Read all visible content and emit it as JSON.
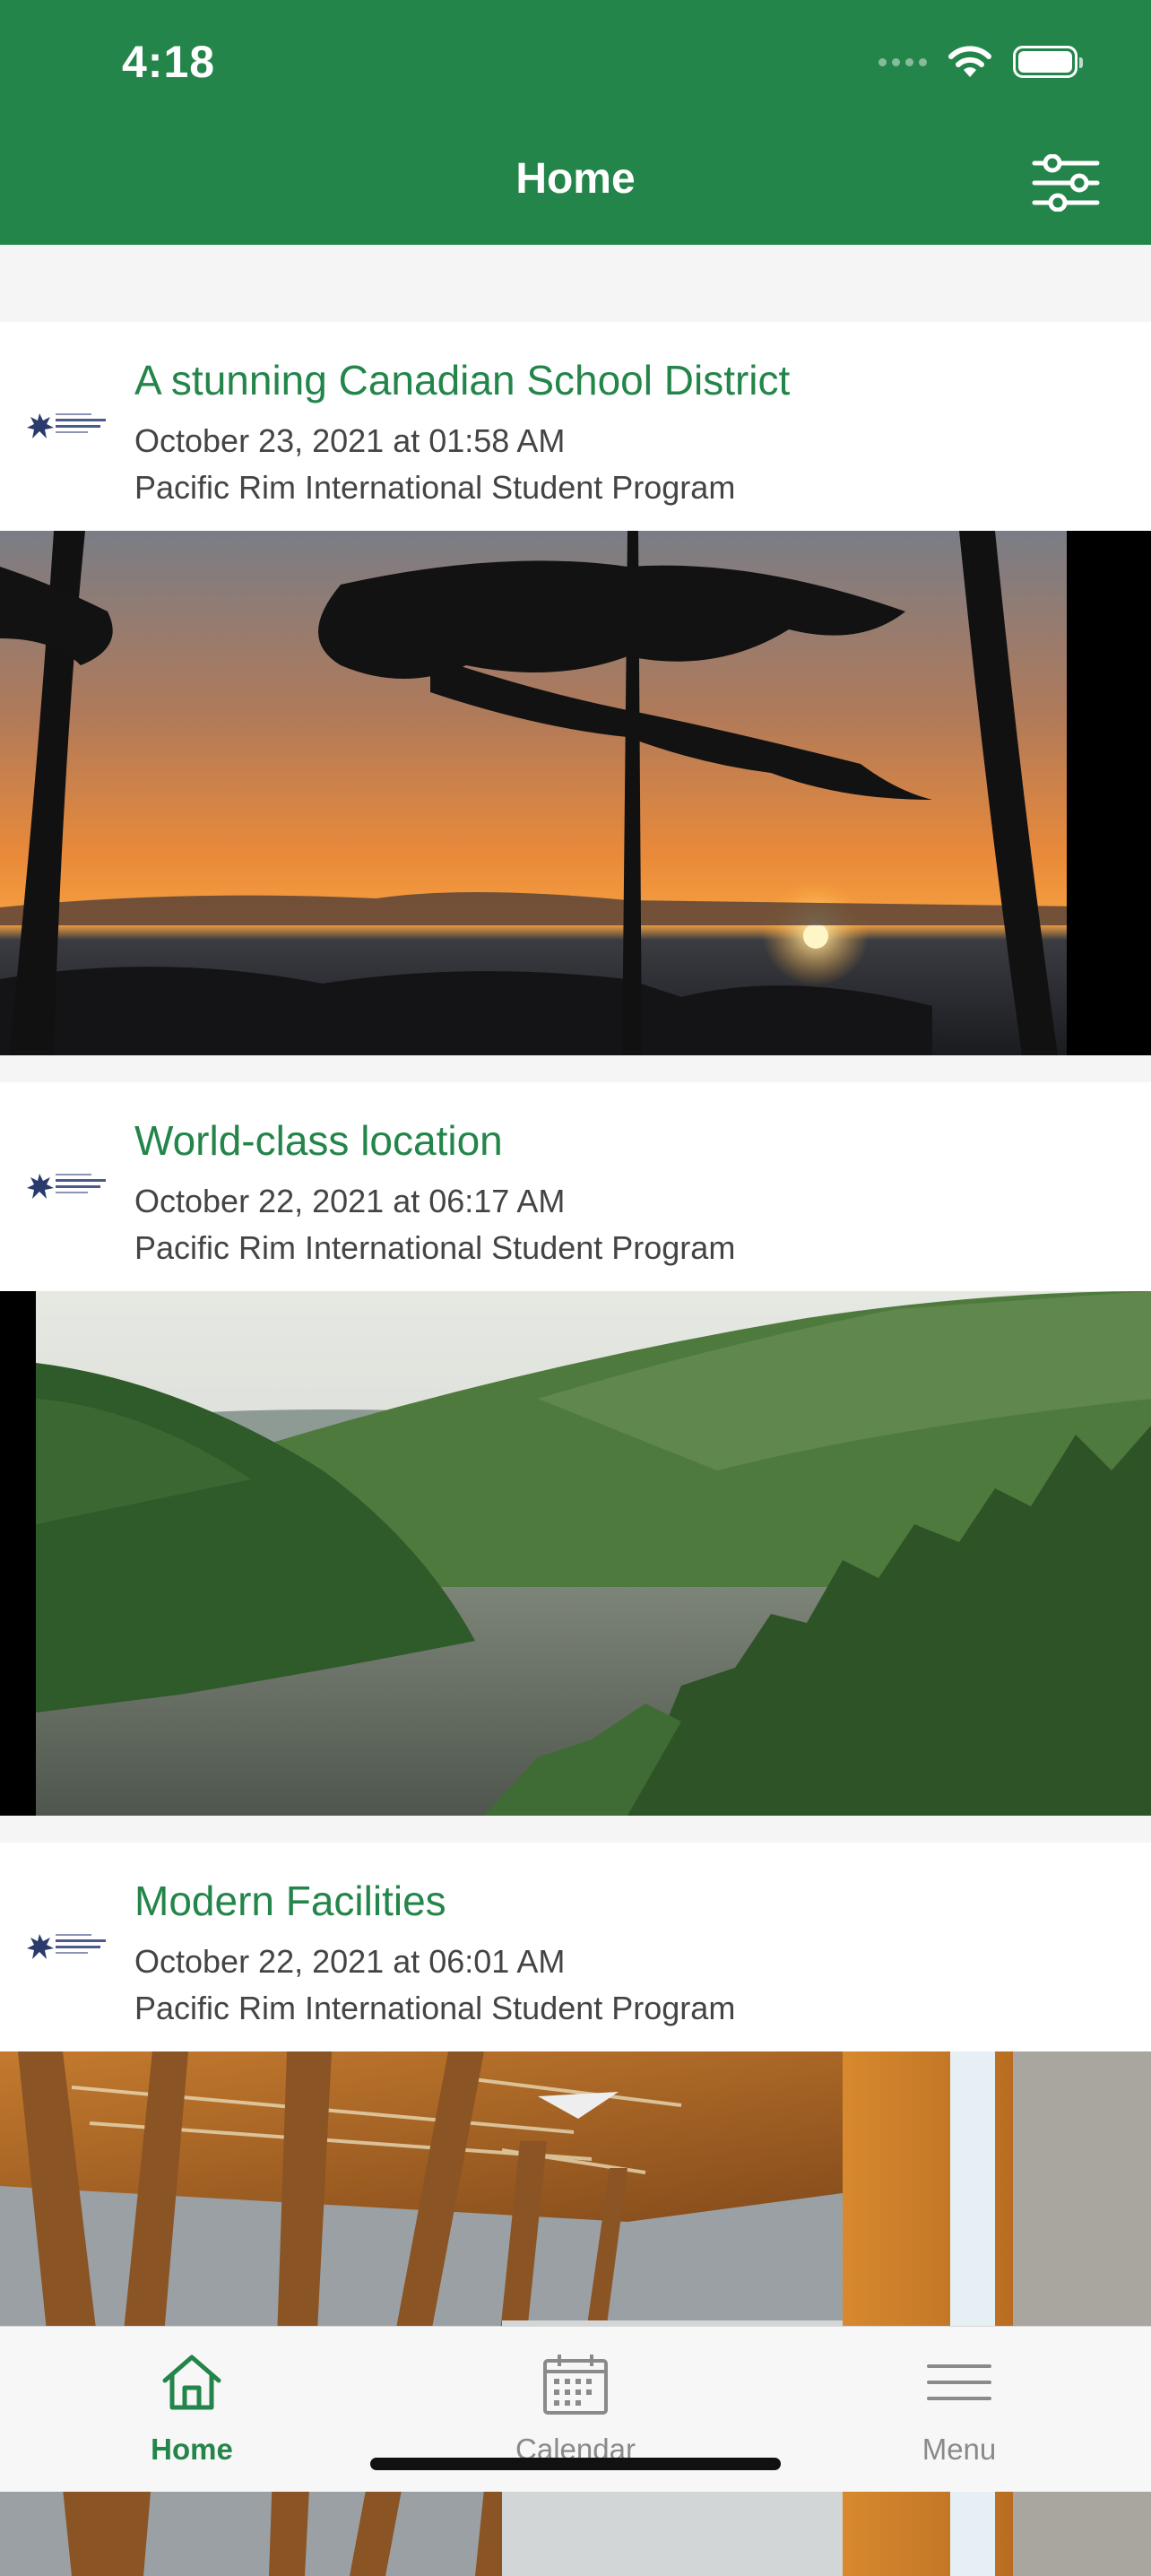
{
  "status_bar": {
    "time": "4:18"
  },
  "header": {
    "title": "Home"
  },
  "posts": [
    {
      "title": "A stunning Canadian School District",
      "date": "October 23, 2021 at 01:58 AM",
      "source": "Pacific Rim International Student Program",
      "image": "sunset-forest-photo"
    },
    {
      "title": "World-class location",
      "date": "October 22, 2021 at 06:17 AM",
      "source": "Pacific Rim International Student Program",
      "image": "inlet-mountains-photo"
    },
    {
      "title": "Modern Facilities",
      "date": "October 22, 2021 at 06:01 AM",
      "source": "Pacific Rim International Student Program",
      "image": "wooden-atrium-photo"
    }
  ],
  "tabs": [
    {
      "label": "Home",
      "icon": "home-icon",
      "active": true
    },
    {
      "label": "Calendar",
      "icon": "calendar-icon",
      "active": false
    },
    {
      "label": "Menu",
      "icon": "menu-icon",
      "active": false
    }
  ],
  "colors": {
    "primary": "#24854a",
    "inactive": "#8a8a8a"
  }
}
